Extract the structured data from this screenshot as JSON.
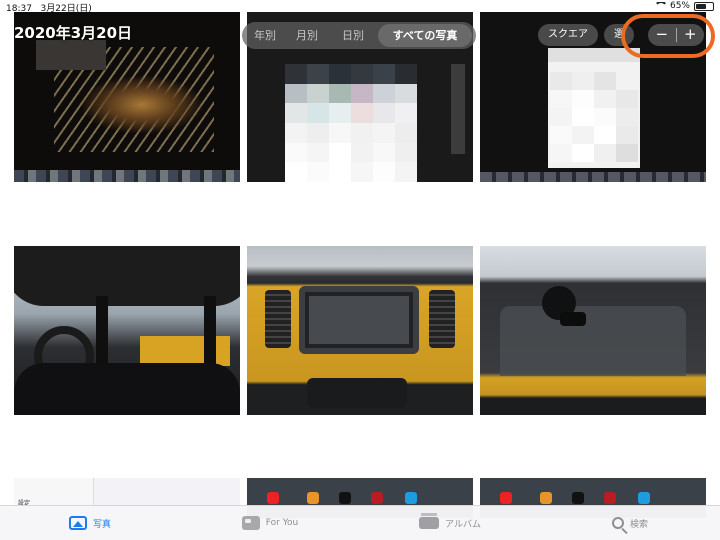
{
  "status_bar": {
    "time": "18:37",
    "date": "3月22日(日)",
    "battery": "65%",
    "battery_level": 0.65
  },
  "header": {
    "date_title": "2020年3月20日"
  },
  "view_segments": [
    {
      "label": "年別",
      "active": false
    },
    {
      "label": "月別",
      "active": false
    },
    {
      "label": "日別",
      "active": false
    },
    {
      "label": "すべての写真",
      "active": true
    }
  ],
  "toolbar": {
    "square_label": "スクエア",
    "select_label": "選",
    "zoom_out_label": "−",
    "zoom_in_label": "+"
  },
  "tile_texts": {
    "settings_label": "設定"
  },
  "tab_bar": {
    "items": [
      {
        "label": "写真",
        "icon": "photos-icon",
        "active": true
      },
      {
        "label": "For You",
        "icon": "for-you-icon",
        "active": false
      },
      {
        "label": "アルバム",
        "icon": "albums-icon",
        "active": false
      },
      {
        "label": "検索",
        "icon": "search-icon",
        "active": false
      }
    ]
  },
  "colors": {
    "accent": "#1a7cf0",
    "highlight_ring": "#ec6a22"
  }
}
